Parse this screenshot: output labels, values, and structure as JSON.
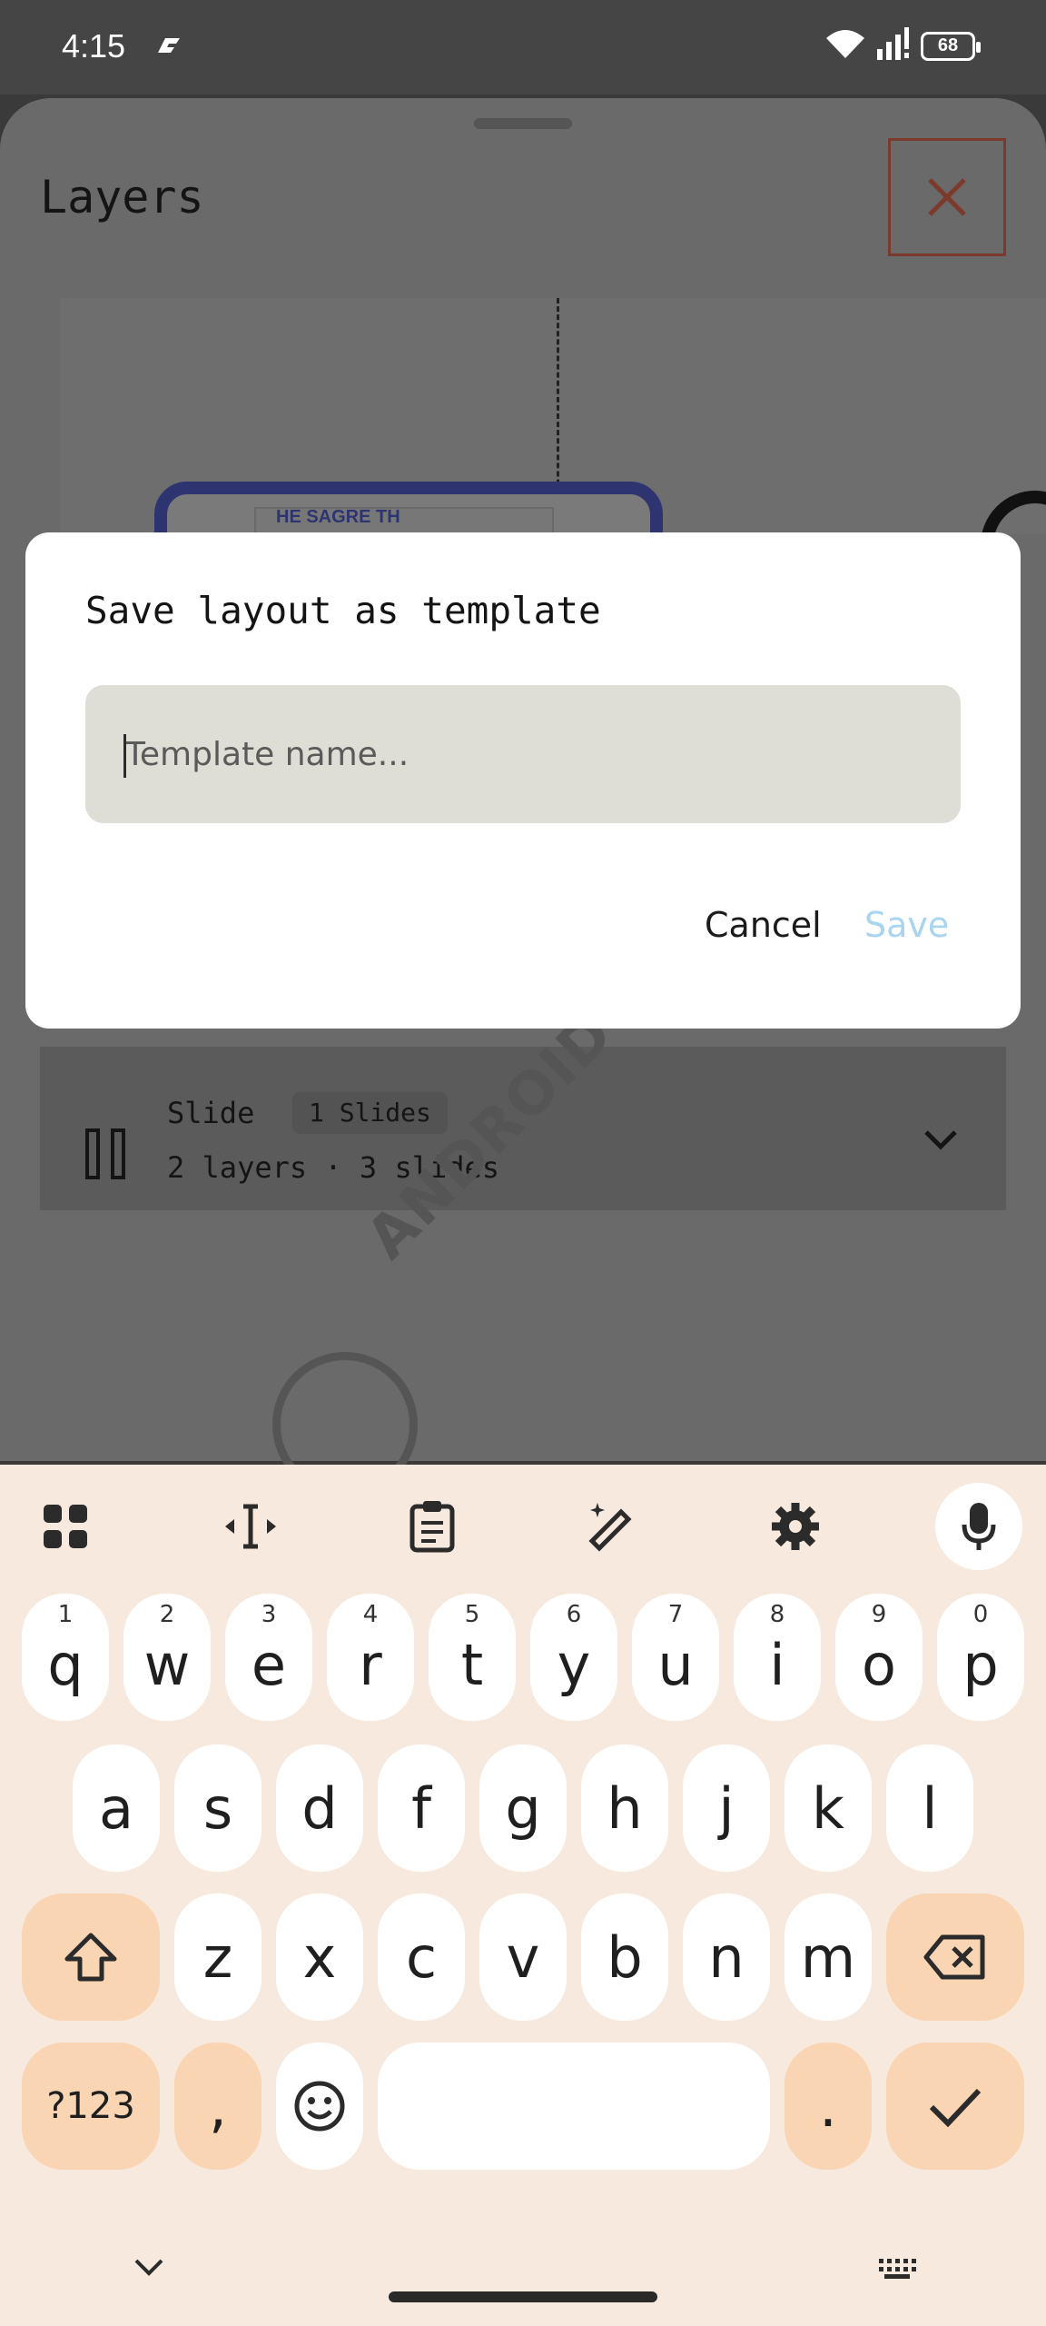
{
  "status_bar": {
    "time": "4:15",
    "battery": "68"
  },
  "sheet": {
    "title": "Layers",
    "preview": {
      "card_text": "HE SAGRE TH"
    },
    "layer": {
      "title": "Slide",
      "badge": "1 Slides",
      "subtitle": "2 layers · 3 slides"
    },
    "watermark": "ANDROID AUTHORITY"
  },
  "dialog": {
    "title": "Save layout as template",
    "input_placeholder": "Template name...",
    "input_value": "",
    "cancel_label": "Cancel",
    "save_label": "Save"
  },
  "keyboard": {
    "toolbar_icons": [
      "apps-icon",
      "text-cursor-icon",
      "clipboard-icon",
      "magic-pen-icon",
      "settings-icon",
      "microphone-icon"
    ],
    "row1": [
      {
        "key": "q",
        "hint": "1"
      },
      {
        "key": "w",
        "hint": "2"
      },
      {
        "key": "e",
        "hint": "3"
      },
      {
        "key": "r",
        "hint": "4"
      },
      {
        "key": "t",
        "hint": "5"
      },
      {
        "key": "y",
        "hint": "6"
      },
      {
        "key": "u",
        "hint": "7"
      },
      {
        "key": "i",
        "hint": "8"
      },
      {
        "key": "o",
        "hint": "9"
      },
      {
        "key": "p",
        "hint": "0"
      }
    ],
    "row2": [
      "a",
      "s",
      "d",
      "f",
      "g",
      "h",
      "j",
      "k",
      "l"
    ],
    "row3": [
      "z",
      "x",
      "c",
      "v",
      "b",
      "n",
      "m"
    ],
    "symbols_label": "?123",
    "comma_label": ",",
    "period_label": "."
  },
  "colors": {
    "keyboard_bg": "#f7e9dd",
    "special_key": "#f9d5b3",
    "save_disabled": "#a9d4ef",
    "close_icon": "#7c3a2c"
  }
}
